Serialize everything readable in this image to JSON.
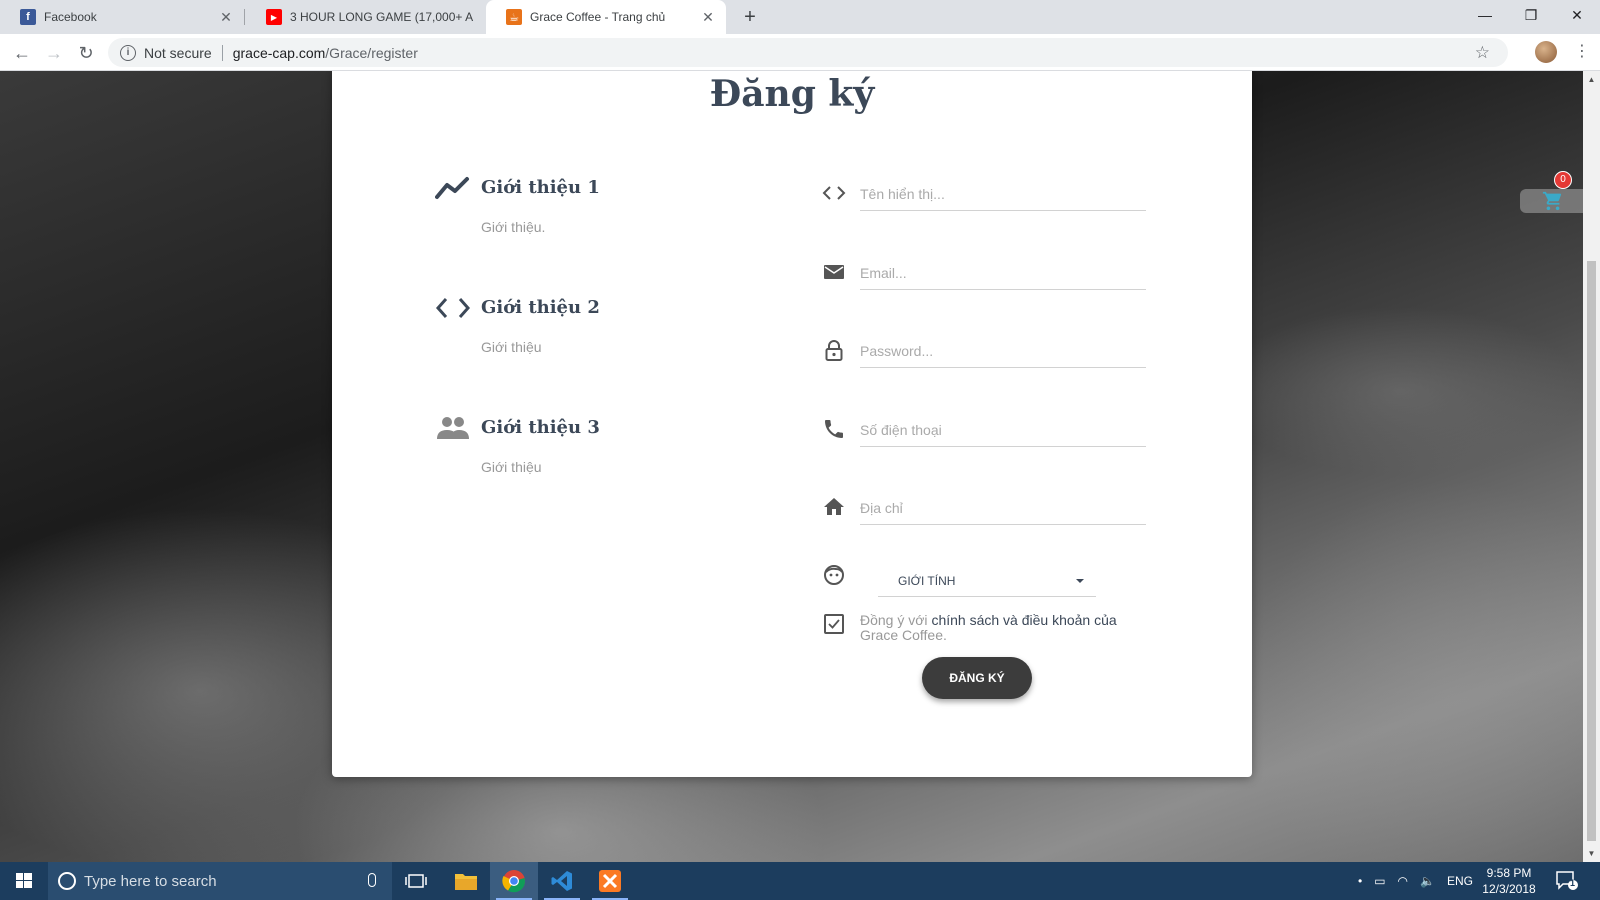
{
  "browser": {
    "tabs": [
      {
        "title": "Facebook",
        "favicon": "facebook-icon",
        "active": false
      },
      {
        "title": "3 HOUR LONG GAME (17,000+ A",
        "favicon": "youtube-icon",
        "active": false
      },
      {
        "title": "Grace Coffee - Trang chủ",
        "favicon": "grace-coffee-icon",
        "active": true
      }
    ],
    "security_label": "Not secure",
    "url_host": "grace-cap.com",
    "url_path": "/Grace/register"
  },
  "page": {
    "title": "Đăng ký",
    "info": [
      {
        "icon": "trending-up-icon",
        "title": "Giới thiệu 1",
        "desc": "Giới thiệu."
      },
      {
        "icon": "code-icon",
        "title": "Giới thiệu 2",
        "desc": "Giới thiệu"
      },
      {
        "icon": "people-icon",
        "title": "Giới thiệu 3",
        "desc": "Giới thiệu"
      }
    ],
    "form": {
      "name_placeholder": "Tên hiển thị...",
      "email_placeholder": "Email...",
      "password_placeholder": "Password...",
      "phone_placeholder": "Số điện thoại",
      "address_placeholder": "Địa chỉ",
      "gender_label": "GIỚI TÍNH",
      "agree_prefix": "Đồng ý với ",
      "agree_link": "chính sách và điều khoản của",
      "agree_suffix": " Grace Coffee.",
      "agree_checked": true,
      "submit_label": "ĐĂNG KÝ"
    },
    "cart": {
      "count": "0",
      "accent": "#3ba9c7",
      "badge_color": "#e53935"
    }
  },
  "taskbar": {
    "search_placeholder": "Type here to search",
    "apps": [
      "task-view-icon",
      "file-explorer-icon",
      "chrome-icon",
      "vscode-icon",
      "xampp-icon"
    ],
    "language": "ENG",
    "time": "9:58 PM",
    "date": "12/3/2018",
    "notification_count": "1"
  }
}
